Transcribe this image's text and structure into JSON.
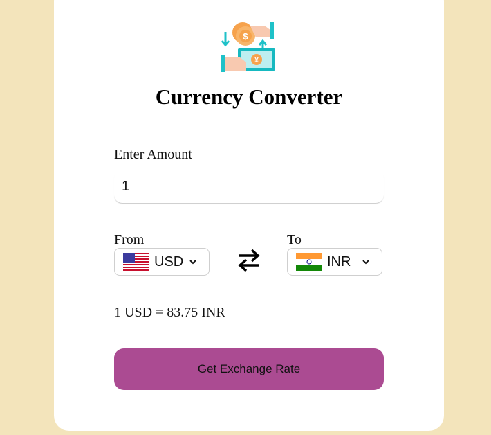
{
  "app": {
    "title": "Currency Converter",
    "logo_icon": "money-exchange-icon"
  },
  "amount": {
    "label": "Enter Amount",
    "value": "1"
  },
  "from": {
    "label": "From",
    "currency": "USD",
    "flag_icon": "us-flag-icon"
  },
  "to": {
    "label": "To",
    "currency": "INR",
    "flag_icon": "india-flag-icon"
  },
  "swap_icon": "swap-arrows-icon",
  "result": {
    "text": "1 USD = 83.75 INR"
  },
  "button": {
    "label": "Get Exchange Rate"
  },
  "colors": {
    "background": "#f3e4bb",
    "card": "#ffffff",
    "button": "#ab4b92"
  }
}
